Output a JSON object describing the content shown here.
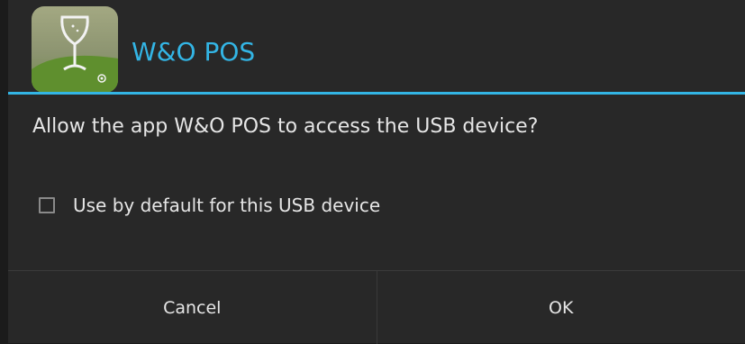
{
  "dialog": {
    "title": "W&O POS",
    "message": "Allow the app W&O POS to access the USB device?",
    "checkbox": {
      "label": "Use by default for this USB device",
      "checked": false
    },
    "buttons": {
      "cancel_label": "Cancel",
      "ok_label": "OK"
    },
    "icon": "wine-glass-app-icon"
  },
  "colors": {
    "accent": "#33b5e5",
    "dialog_background": "#282828",
    "text": "#e6e6e6",
    "outer_background": "#1b1b1b"
  }
}
